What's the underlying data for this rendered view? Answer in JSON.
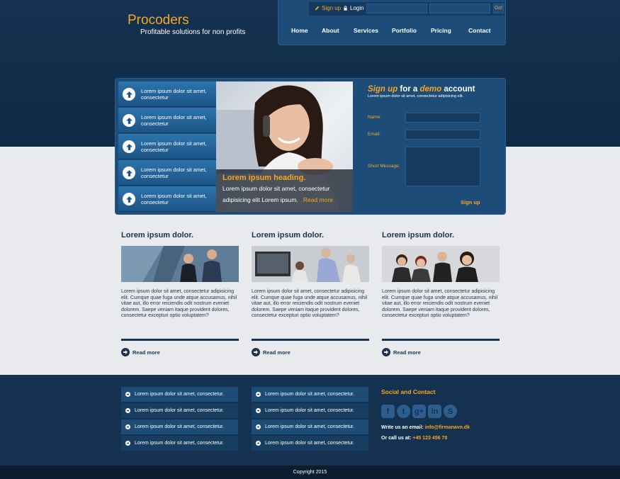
{
  "brand": {
    "title": "Procoders",
    "tagline": "Profitable solutions for non profits"
  },
  "topbar": {
    "signup": "Sign up",
    "login": "Login",
    "go": "Go!"
  },
  "nav": [
    "Home",
    "About",
    "Services",
    "Portfolio",
    "Pricing",
    "Contact"
  ],
  "hero": {
    "side_items": [
      "Lorem ipsum dolor sit amet, consectetur",
      "Lorem ipsum dolor sit amet, consectetur",
      "Lorem ipsum dolor sit amet, consectetur",
      "Lorem ipsum dolor sit amet, consectetur",
      "Lorem ipsum dolor sit amet, consectetur"
    ],
    "caption_heading": "Lorem ipsum heading.",
    "caption_text": "Lorem ipsum dolor sit amet, consectetur adipisicing elit Lorem ipsum.",
    "caption_more": "Read more"
  },
  "signup_form": {
    "title_a": "Sign up",
    "title_b": " for a ",
    "title_c": "demo",
    "title_d": " account",
    "subtitle": "Lorem ipsum dolor sit amet, consectetur adipisicing elit.",
    "name_label": "Name:",
    "email_label": "Email:",
    "message_label": "Short Message:",
    "button": "Sign up"
  },
  "columns": [
    {
      "title": "Lorem ipsum dolor.",
      "text": "Lorem ipsum dolor sit amet, consectetur adipisicing elit. Cumque quae fuga unde atque accusamus, nihil vitae aut, illo error reiciendis odit nostrum eveniet dolorem. Saepe veniam itaque provident dolores, consectetur excepturi optio voluptatem?",
      "more": "Read more"
    },
    {
      "title": "Lorem ipsum dolor.",
      "text": "Lorem ipsum dolor sit amet, consectetur adipisicing elit. Cumque quae fuga unde atque accusamus, nihil vitae aut, illo error reiciendis odit nostrum eveniet dolorem. Saepe veniam itaque provident dolores, consectetur excepturi optio voluptatem?",
      "more": "Read more"
    },
    {
      "title": "Lorem ipsum dolor.",
      "text": "Lorem ipsum dolor sit amet, consectetur adipisicing elit. Cumque quae fuga unde atque accusamus, nihil vitae aut, illo error reiciendis odit nostrum eveniet dolorem. Saepe veniam itaque provident dolores, consectetur excepturi optio voluptatem?",
      "more": "Read more"
    }
  ],
  "footer": {
    "list_a": [
      "Lorem ipsum dolor sit amet, consectetur.",
      "Lorem ipsum dolor sit amet, consectetur.",
      "Lorem ipsum dolor sit amet, consectetur.",
      "Lorem ipsum dolor sit amet, consectetur."
    ],
    "list_b": [
      "Lorem ipsum dolor sit amet, consectetur.",
      "Lorem ipsum dolor sit amet, consectetur.",
      "Lorem ipsum dolor sit amet, consectetur.",
      "Lorem ipsum dolor sit amet, consectetur."
    ],
    "social_title": "Social and Contact",
    "social_icons": [
      "facebook-icon",
      "twitter-icon",
      "google-plus-icon",
      "linkedin-icon",
      "skype-icon"
    ],
    "email_label": "Write us an email: ",
    "email_value": "info@firmanavn.dk",
    "phone_label": "Or call us at: ",
    "phone_value": "+45 123 456 78",
    "copyright": "Copyright 2015"
  },
  "colors": {
    "accent": "#f5a623",
    "dark": "#143250",
    "panel": "#1e4c78"
  }
}
